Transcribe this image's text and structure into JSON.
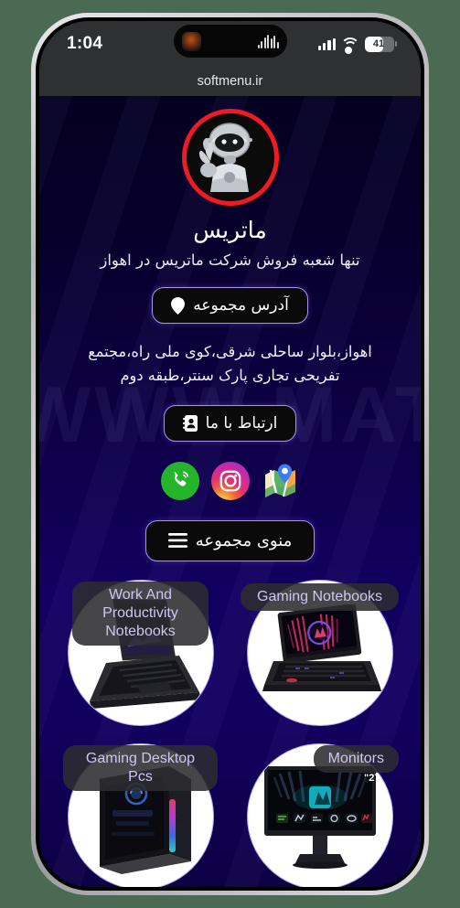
{
  "status_bar": {
    "time": "1:04",
    "battery_level": "41",
    "signal_icon": "cellular-signal-icon",
    "wifi_icon": "wifi-icon",
    "battery_icon": "battery-icon",
    "dynamic_island_icon": "media-activity-icon"
  },
  "browser": {
    "url": "softmenu.ir"
  },
  "profile": {
    "avatar_icon": "robot-avatar-icon",
    "avatar_border_color": "#ed1c24",
    "title": "ماتریس",
    "description": "تنها شعبه فروش شرکت ماتریس در اهواز"
  },
  "watermark": {
    "text": "WWW.MATRIX"
  },
  "address": {
    "button_label": "آدرس مجموعه",
    "button_icon": "location-pin-icon",
    "text": "اهواز،بلوار ساحلی شرقی،کوی ملی راه،مجتمع تفریحی تجاری پارک سنتر،طبقه دوم"
  },
  "contact": {
    "button_label": "ارتباط با ما",
    "button_icon": "contact-card-icon"
  },
  "social": [
    {
      "name": "whatsapp",
      "icon": "whatsapp-icon",
      "color": "#25b52b"
    },
    {
      "name": "instagram",
      "icon": "instagram-icon",
      "color": "#e5316f"
    },
    {
      "name": "google-maps",
      "icon": "google-maps-icon",
      "color": "#4285f4"
    }
  ],
  "menu": {
    "button_label": "منوی مجموعه",
    "button_icon": "hamburger-menu-icon"
  },
  "categories": [
    {
      "label": "Gaming Notebooks",
      "image": "gaming-laptop-image"
    },
    {
      "label": "Work And Productivity Notebooks",
      "image": "work-laptop-image"
    },
    {
      "label": "Monitors",
      "image": "gaming-monitor-image"
    },
    {
      "label": "Gaming Desktop Pcs",
      "image": "desktop-pc-tower-image"
    }
  ],
  "theme": {
    "page_background": "#0d0045",
    "accent_border": "#a891f0",
    "button_background": "#0a0a0a"
  }
}
